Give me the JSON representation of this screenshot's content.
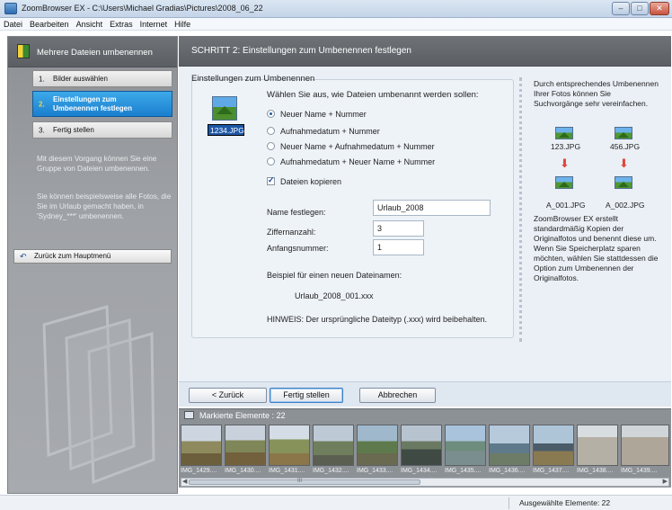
{
  "window": {
    "title": "ZoomBrowser EX  -  C:\\Users\\Michael Gradias\\Pictures\\2008_06_22",
    "minimize": "–",
    "maximize": "□",
    "close": "✕"
  },
  "menu": [
    "Datei",
    "Bearbeiten",
    "Ansicht",
    "Extras",
    "Internet",
    "Hilfe"
  ],
  "left": {
    "title": "Mehrere Dateien umbenennen",
    "steps": [
      {
        "num": "1.",
        "label": "Bilder auswählen",
        "active": false
      },
      {
        "num": "2.",
        "label": "Einstellungen zum Umbenennen festlegen",
        "active": true
      },
      {
        "num": "3.",
        "label": "Fertig stellen",
        "active": false
      }
    ],
    "desc1": "Mit diesem Vorgang können Sie eine Gruppe von Dateien umbenennen.",
    "desc2": "Sie können beispielsweise alle Fotos, die Sie im Urlaub gemacht haben, in 'Sydney_***' umbenennen.",
    "back_main": "Zurück zum Hauptmenü"
  },
  "header": {
    "step_title": "SCHRITT 2: Einstellungen zum Umbenennen festlegen"
  },
  "settings": {
    "group_title": "Einstellungen zum Umbenennen",
    "thumb_label": "1234.JPG",
    "question": "Wählen Sie aus, wie Dateien umbenannt werden sollen:",
    "options": [
      "Neuer Name + Nummer",
      "Aufnahmedatum + Nummer",
      "Neuer Name + Aufnahmedatum + Nummer",
      "Aufnahmedatum + Neuer Name + Nummer"
    ],
    "selected_option": "Neuer Name + Nummer",
    "copy_files": "Dateien kopieren",
    "copy_files_checked": true,
    "name_label": "Name festlegen:",
    "name_value": "Urlaub_2008",
    "digits_label": "Ziffernanzahl:",
    "digits_value": "3",
    "start_label": "Anfangsnummer:",
    "start_value": "1",
    "example_label": "Beispiel für einen neuen Dateinamen:",
    "example_value": "Urlaub_2008_001.xxx",
    "hint": "HINWEIS: Der ursprüngliche Dateityp (.xxx) wird beibehalten."
  },
  "right_panel": {
    "intro": "Durch entsprechendes Umbenennen Ihrer Fotos können Sie Suchvorgänge sehr vereinfachen.",
    "before": [
      "123.JPG",
      "456.JPG"
    ],
    "after": [
      "A_001.JPG",
      "A_002.JPG"
    ],
    "note": "ZoomBrowser EX erstellt standardmäßig Kopien der Originalfotos und benennt diese um. Wenn Sie Speicherplatz sparen möchten, wählen Sie stattdessen die Option zum Umbenennen der Originalfotos."
  },
  "buttons": {
    "back": "< Zurück",
    "finish": "Fertig stellen",
    "cancel": "Abbrechen"
  },
  "filmstrip": {
    "header": "Markierte Elemente : 22",
    "items": [
      "IMG_1429....",
      "IMG_1430....",
      "IMG_1431....",
      "IMG_1432....",
      "IMG_1433....",
      "IMG_1434....",
      "IMG_1435....",
      "IMG_1436....",
      "IMG_1437....",
      "IMG_1438....",
      "IMG_1439...."
    ],
    "scroll_mark": "III"
  },
  "status": {
    "text": "Ausgewählte Elemente: 22"
  }
}
